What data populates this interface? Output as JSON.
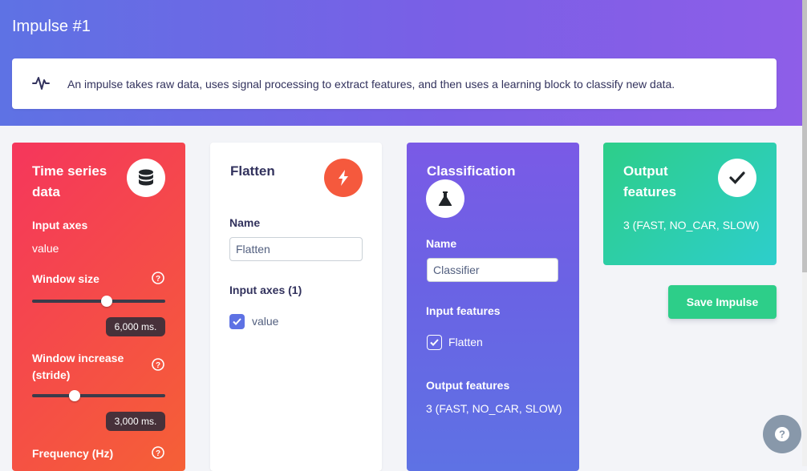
{
  "page": {
    "title": "Impulse #1"
  },
  "info": {
    "icon": "activity-icon",
    "text": "An impulse takes raw data, uses signal processing to extract features, and then uses a learning block to classify new data."
  },
  "time_series": {
    "title": "Time series data",
    "icon": "database-icon",
    "input_axes_label": "Input axes",
    "input_axes_value": "value",
    "window_size_label": "Window size",
    "window_size_value": "6,000 ms.",
    "window_size_fraction": 0.56,
    "window_increase_label": "Window increase (stride)",
    "window_increase_value": "3,000 ms.",
    "window_increase_fraction": 0.32,
    "frequency_label": "Frequency (Hz)"
  },
  "flatten": {
    "title": "Flatten",
    "icon": "bolt-icon",
    "name_label": "Name",
    "name_value": "Flatten",
    "input_axes_label": "Input axes (1)",
    "axis_item": "value"
  },
  "classification": {
    "title": "Classification",
    "icon": "flask-icon",
    "name_label": "Name",
    "name_value": "Classifier",
    "input_features_label": "Input features",
    "feature_item": "Flatten",
    "output_features_label": "Output features",
    "output_features_value": "3 (FAST, NO_CAR, SLOW)"
  },
  "output": {
    "title": "Output features",
    "icon": "check-icon",
    "value": "3 (FAST, NO_CAR, SLOW)"
  },
  "actions": {
    "save_label": "Save Impulse"
  },
  "colors": {
    "header": "#5e72e4",
    "time_series": "#f5365c",
    "classification": "#7a5ae6",
    "output": "#2dce89",
    "checkbox": "#5e72e4"
  }
}
